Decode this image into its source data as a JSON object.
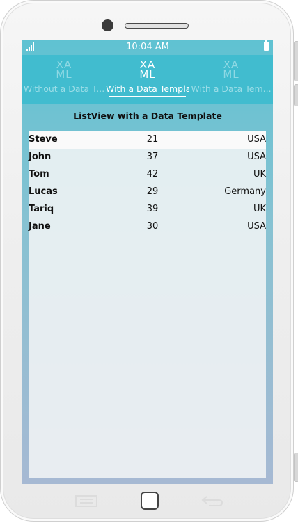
{
  "status": {
    "time": "10:04 AM"
  },
  "tabs": [
    {
      "icon": "xaml-icon",
      "icon_line1": "XA",
      "icon_line2": "ML",
      "label": "Without a Data T..."
    },
    {
      "icon": "xaml-icon",
      "icon_line1": "XA",
      "icon_line2": "ML",
      "label": "With a Data Templa"
    },
    {
      "icon": "xaml-icon",
      "icon_line1": "XA",
      "icon_line2": "ML",
      "label": "With a Data Tem..."
    }
  ],
  "active_tab_index": 1,
  "page": {
    "title": "ListView with a Data Template"
  },
  "people": [
    {
      "name": "Steve",
      "age": "21",
      "country": "USA"
    },
    {
      "name": "John",
      "age": "37",
      "country": "USA"
    },
    {
      "name": "Tom",
      "age": "42",
      "country": "UK"
    },
    {
      "name": "Lucas",
      "age": "29",
      "country": "Germany"
    },
    {
      "name": "Tariq",
      "age": "39",
      "country": "UK"
    },
    {
      "name": "Jane",
      "age": "30",
      "country": "USA"
    }
  ],
  "colors": {
    "tabbar": "#41bccf",
    "accent": "#ffffff"
  },
  "nav": {
    "icons": [
      "recent-apps-icon",
      "home-icon",
      "back-icon"
    ]
  }
}
